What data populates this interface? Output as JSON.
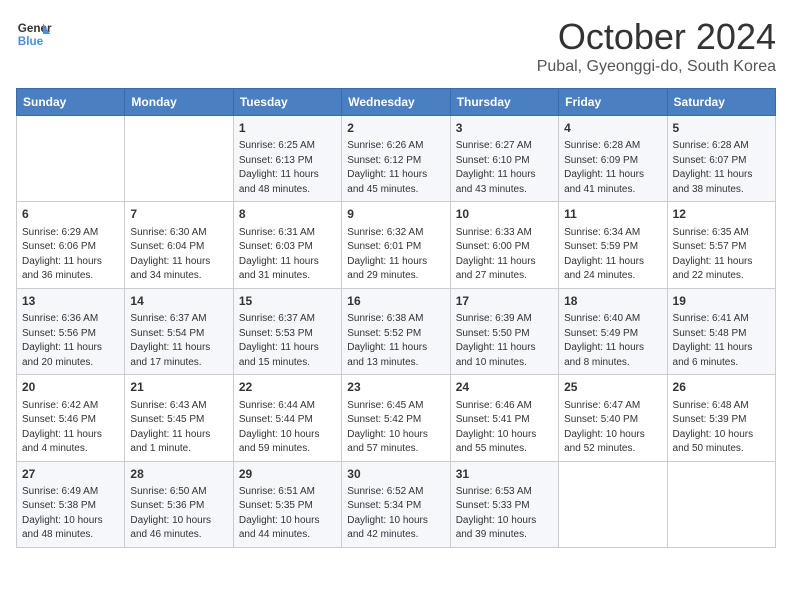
{
  "header": {
    "logo_line1": "General",
    "logo_line2": "Blue",
    "month": "October 2024",
    "location": "Pubal, Gyeonggi-do, South Korea"
  },
  "days_of_week": [
    "Sunday",
    "Monday",
    "Tuesday",
    "Wednesday",
    "Thursday",
    "Friday",
    "Saturday"
  ],
  "weeks": [
    [
      {
        "day": "",
        "sunrise": "",
        "sunset": "",
        "daylight": ""
      },
      {
        "day": "",
        "sunrise": "",
        "sunset": "",
        "daylight": ""
      },
      {
        "day": "1",
        "sunrise": "Sunrise: 6:25 AM",
        "sunset": "Sunset: 6:13 PM",
        "daylight": "Daylight: 11 hours and 48 minutes."
      },
      {
        "day": "2",
        "sunrise": "Sunrise: 6:26 AM",
        "sunset": "Sunset: 6:12 PM",
        "daylight": "Daylight: 11 hours and 45 minutes."
      },
      {
        "day": "3",
        "sunrise": "Sunrise: 6:27 AM",
        "sunset": "Sunset: 6:10 PM",
        "daylight": "Daylight: 11 hours and 43 minutes."
      },
      {
        "day": "4",
        "sunrise": "Sunrise: 6:28 AM",
        "sunset": "Sunset: 6:09 PM",
        "daylight": "Daylight: 11 hours and 41 minutes."
      },
      {
        "day": "5",
        "sunrise": "Sunrise: 6:28 AM",
        "sunset": "Sunset: 6:07 PM",
        "daylight": "Daylight: 11 hours and 38 minutes."
      }
    ],
    [
      {
        "day": "6",
        "sunrise": "Sunrise: 6:29 AM",
        "sunset": "Sunset: 6:06 PM",
        "daylight": "Daylight: 11 hours and 36 minutes."
      },
      {
        "day": "7",
        "sunrise": "Sunrise: 6:30 AM",
        "sunset": "Sunset: 6:04 PM",
        "daylight": "Daylight: 11 hours and 34 minutes."
      },
      {
        "day": "8",
        "sunrise": "Sunrise: 6:31 AM",
        "sunset": "Sunset: 6:03 PM",
        "daylight": "Daylight: 11 hours and 31 minutes."
      },
      {
        "day": "9",
        "sunrise": "Sunrise: 6:32 AM",
        "sunset": "Sunset: 6:01 PM",
        "daylight": "Daylight: 11 hours and 29 minutes."
      },
      {
        "day": "10",
        "sunrise": "Sunrise: 6:33 AM",
        "sunset": "Sunset: 6:00 PM",
        "daylight": "Daylight: 11 hours and 27 minutes."
      },
      {
        "day": "11",
        "sunrise": "Sunrise: 6:34 AM",
        "sunset": "Sunset: 5:59 PM",
        "daylight": "Daylight: 11 hours and 24 minutes."
      },
      {
        "day": "12",
        "sunrise": "Sunrise: 6:35 AM",
        "sunset": "Sunset: 5:57 PM",
        "daylight": "Daylight: 11 hours and 22 minutes."
      }
    ],
    [
      {
        "day": "13",
        "sunrise": "Sunrise: 6:36 AM",
        "sunset": "Sunset: 5:56 PM",
        "daylight": "Daylight: 11 hours and 20 minutes."
      },
      {
        "day": "14",
        "sunrise": "Sunrise: 6:37 AM",
        "sunset": "Sunset: 5:54 PM",
        "daylight": "Daylight: 11 hours and 17 minutes."
      },
      {
        "day": "15",
        "sunrise": "Sunrise: 6:37 AM",
        "sunset": "Sunset: 5:53 PM",
        "daylight": "Daylight: 11 hours and 15 minutes."
      },
      {
        "day": "16",
        "sunrise": "Sunrise: 6:38 AM",
        "sunset": "Sunset: 5:52 PM",
        "daylight": "Daylight: 11 hours and 13 minutes."
      },
      {
        "day": "17",
        "sunrise": "Sunrise: 6:39 AM",
        "sunset": "Sunset: 5:50 PM",
        "daylight": "Daylight: 11 hours and 10 minutes."
      },
      {
        "day": "18",
        "sunrise": "Sunrise: 6:40 AM",
        "sunset": "Sunset: 5:49 PM",
        "daylight": "Daylight: 11 hours and 8 minutes."
      },
      {
        "day": "19",
        "sunrise": "Sunrise: 6:41 AM",
        "sunset": "Sunset: 5:48 PM",
        "daylight": "Daylight: 11 hours and 6 minutes."
      }
    ],
    [
      {
        "day": "20",
        "sunrise": "Sunrise: 6:42 AM",
        "sunset": "Sunset: 5:46 PM",
        "daylight": "Daylight: 11 hours and 4 minutes."
      },
      {
        "day": "21",
        "sunrise": "Sunrise: 6:43 AM",
        "sunset": "Sunset: 5:45 PM",
        "daylight": "Daylight: 11 hours and 1 minute."
      },
      {
        "day": "22",
        "sunrise": "Sunrise: 6:44 AM",
        "sunset": "Sunset: 5:44 PM",
        "daylight": "Daylight: 10 hours and 59 minutes."
      },
      {
        "day": "23",
        "sunrise": "Sunrise: 6:45 AM",
        "sunset": "Sunset: 5:42 PM",
        "daylight": "Daylight: 10 hours and 57 minutes."
      },
      {
        "day": "24",
        "sunrise": "Sunrise: 6:46 AM",
        "sunset": "Sunset: 5:41 PM",
        "daylight": "Daylight: 10 hours and 55 minutes."
      },
      {
        "day": "25",
        "sunrise": "Sunrise: 6:47 AM",
        "sunset": "Sunset: 5:40 PM",
        "daylight": "Daylight: 10 hours and 52 minutes."
      },
      {
        "day": "26",
        "sunrise": "Sunrise: 6:48 AM",
        "sunset": "Sunset: 5:39 PM",
        "daylight": "Daylight: 10 hours and 50 minutes."
      }
    ],
    [
      {
        "day": "27",
        "sunrise": "Sunrise: 6:49 AM",
        "sunset": "Sunset: 5:38 PM",
        "daylight": "Daylight: 10 hours and 48 minutes."
      },
      {
        "day": "28",
        "sunrise": "Sunrise: 6:50 AM",
        "sunset": "Sunset: 5:36 PM",
        "daylight": "Daylight: 10 hours and 46 minutes."
      },
      {
        "day": "29",
        "sunrise": "Sunrise: 6:51 AM",
        "sunset": "Sunset: 5:35 PM",
        "daylight": "Daylight: 10 hours and 44 minutes."
      },
      {
        "day": "30",
        "sunrise": "Sunrise: 6:52 AM",
        "sunset": "Sunset: 5:34 PM",
        "daylight": "Daylight: 10 hours and 42 minutes."
      },
      {
        "day": "31",
        "sunrise": "Sunrise: 6:53 AM",
        "sunset": "Sunset: 5:33 PM",
        "daylight": "Daylight: 10 hours and 39 minutes."
      },
      {
        "day": "",
        "sunrise": "",
        "sunset": "",
        "daylight": ""
      },
      {
        "day": "",
        "sunrise": "",
        "sunset": "",
        "daylight": ""
      }
    ]
  ]
}
